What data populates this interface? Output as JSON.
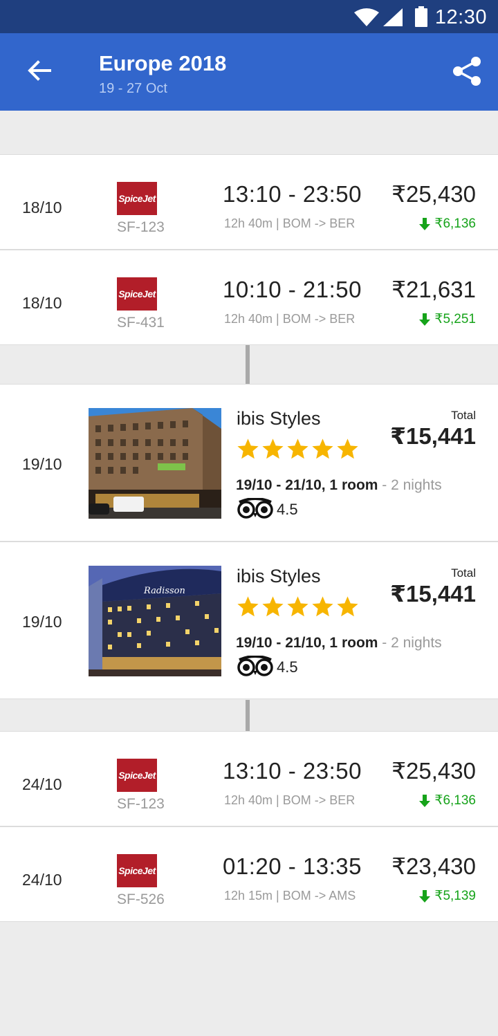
{
  "status": {
    "time": "12:30"
  },
  "header": {
    "title": "Europe 2018",
    "subtitle": "19 - 27 Oct"
  },
  "flights": [
    {
      "date": "18/10",
      "airline": "SpiceJet",
      "flight_no": "SF-123",
      "times": "13:10 - 23:50",
      "route": "12h 40m | BOM -> BER",
      "price": "₹25,430",
      "saving": "₹6,136"
    },
    {
      "date": "18/10",
      "airline": "SpiceJet",
      "flight_no": "SF-431",
      "times": "10:10 - 21:50",
      "route": "12h 40m | BOM -> BER",
      "price": "₹21,631",
      "saving": "₹5,251"
    },
    {
      "date": "24/10",
      "airline": "SpiceJet",
      "flight_no": "SF-123",
      "times": "13:10 - 23:50",
      "route": "12h 40m | BOM -> BER",
      "price": "₹25,430",
      "saving": "₹6,136"
    },
    {
      "date": "24/10",
      "airline": "SpiceJet",
      "flight_no": "SF-526",
      "times": "01:20 - 13:35",
      "route": "12h 15m | BOM -> AMS",
      "price": "₹23,430",
      "saving": "₹5,139"
    }
  ],
  "hotels": [
    {
      "date": "19/10",
      "name": "ibis Styles",
      "stars": 5,
      "stay": "19/10 - 21/10, 1 room",
      "nights": " - 2 nights",
      "rating": "4.5",
      "total_label": "Total",
      "price": "₹15,441"
    },
    {
      "date": "19/10",
      "name": "ibis Styles",
      "stars": 5,
      "stay": "19/10 - 21/10, 1 room",
      "nights": " - 2 nights",
      "rating": "4.5",
      "total_label": "Total",
      "price": "₹15,441"
    }
  ],
  "colors": {
    "app_bar": "#3266cc",
    "status_bar": "#1f3f7f",
    "saving_green": "#16a31a",
    "star": "#f7b500",
    "spicejet_red": "#b21e29"
  }
}
